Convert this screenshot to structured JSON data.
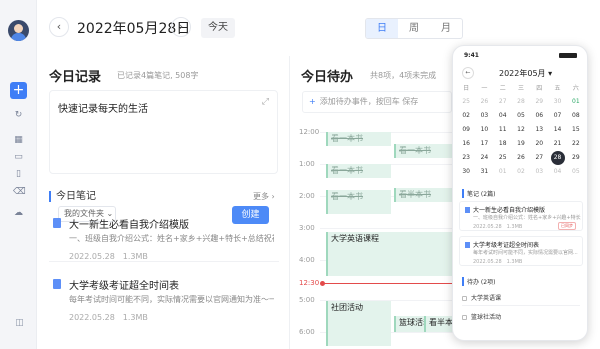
{
  "header": {
    "date": "2022年05月28日",
    "today_label": "今天",
    "views": [
      "日",
      "周",
      "月"
    ],
    "active_view": "日",
    "prev": "‹",
    "next": "›"
  },
  "rail": {
    "add": "+",
    "icons": [
      "sync-icon",
      "grid-icon",
      "folder-icon",
      "book-icon",
      "trash-icon",
      "cloud-icon"
    ]
  },
  "record": {
    "title": "今日记录",
    "stats": "已记录4篇笔记, 508字",
    "editor_text": "快速记录每天的生活",
    "folder_label": "我的文件夹 ⌄",
    "create_label": "创建"
  },
  "notes": {
    "heading": "今日笔记",
    "more_label": "更多 ›",
    "items": [
      {
        "title": "大一新生必看自我介绍模版",
        "desc": "一、班级自我介绍公式：姓名+家乡+兴趣+特长+总结祝福，嘱...",
        "meta": "2022.05.28　1.3MB"
      },
      {
        "title": "大学考级考证超全时间表",
        "desc": "每年考试时间可能不同，实际情况需要以官网通知为准～一月中...",
        "meta": "2022.05.28　1.3MB"
      }
    ]
  },
  "todo": {
    "title": "今日待办",
    "stats": "共8项，4项未完成",
    "add_placeholder": "添加待办事件，按回车",
    "save_label": "保存"
  },
  "timeline": {
    "times": [
      "12:00",
      "1:00",
      "2:00",
      "3:00",
      "4:00",
      "12:30",
      "5:00",
      "6:00"
    ],
    "events": {
      "e1": "看一本书",
      "e2": "看一本书",
      "e3": "看一本书",
      "e4": "看半本书",
      "e5": "看一本书",
      "e6": "大学英语课程",
      "e7": "社团活动",
      "e8": "篮球活动",
      "e9": "看半本书"
    }
  },
  "phone": {
    "time": "9:41",
    "month_label": "2022年05月 ▾",
    "weekdays": [
      "日",
      "一",
      "二",
      "三",
      "四",
      "五",
      "六"
    ],
    "weeks": [
      [
        "25",
        "26",
        "27",
        "28",
        "29",
        "30",
        "01"
      ],
      [
        "02",
        "03",
        "04",
        "05",
        "06",
        "07",
        "08"
      ],
      [
        "09",
        "10",
        "11",
        "12",
        "13",
        "14",
        "15"
      ],
      [
        "16",
        "17",
        "18",
        "19",
        "20",
        "21",
        "22"
      ],
      [
        "23",
        "24",
        "25",
        "26",
        "27",
        "28",
        "29"
      ],
      [
        "30",
        "31",
        "01",
        "02",
        "03",
        "04",
        "05"
      ]
    ],
    "notes_heading": "笔记 (2篇)",
    "note_cards": [
      {
        "title": "大一新生必看自我介绍模版",
        "desc": "一、班级自我介绍公式：姓名+家乡+兴趣+特长...",
        "meta": "2022.05.28　1.3MB",
        "tag": "已同步"
      },
      {
        "title": "大学考级考证超全时间表",
        "desc": "每年考试时间可能不同，实际情况需要以官网...",
        "meta": "2022.05.28　1.3MB",
        "tag": ""
      }
    ],
    "todo_heading": "待办 (2项)",
    "todos": [
      "大学英语课",
      "篮球社活动"
    ]
  },
  "colors": {
    "accent": "#3f7ef6",
    "event_bg": "#e3f3ec",
    "now_line": "#e34b4b"
  }
}
